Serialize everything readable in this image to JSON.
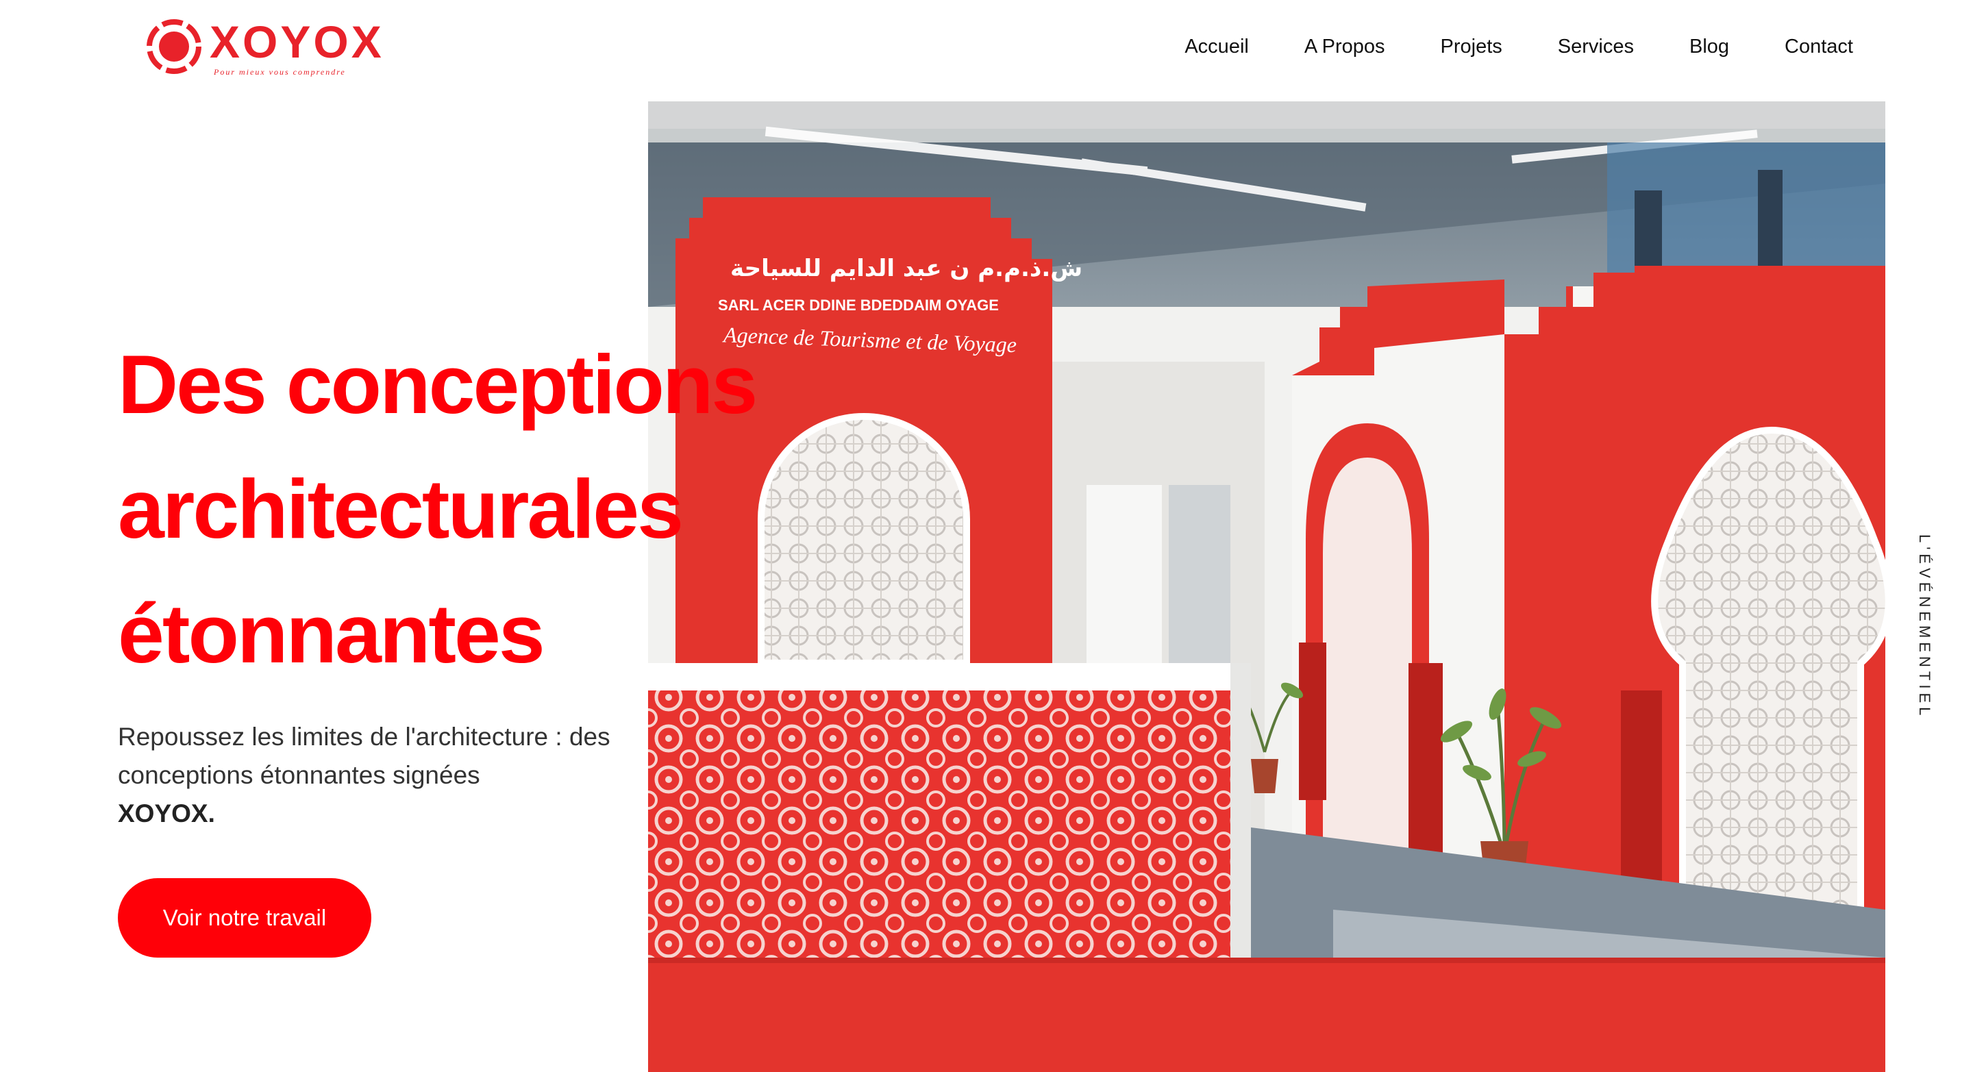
{
  "header": {
    "logo_text": "XOYOX",
    "logo_tagline": "Pour mieux vous comprendre",
    "nav": [
      {
        "label": "Accueil"
      },
      {
        "label": "A Propos"
      },
      {
        "label": "Projets"
      },
      {
        "label": "Services"
      },
      {
        "label": "Blog"
      },
      {
        "label": "Contact"
      }
    ]
  },
  "hero": {
    "title_lines": [
      "Des conceptions",
      "architecturales",
      "étonnantes"
    ],
    "subtitle": "Repoussez les limites de l'architecture : des conceptions étonnantes signées",
    "subtitle_brand": "XOYOX.",
    "cta_label": "Voir notre travail",
    "side_label": "L'ÉVÉNEMENTIEL",
    "photo": {
      "sign_arabic": "ش.ذ.م.م  ن عبد الدايم للسياحة",
      "sign_line1": "SARL  ACER  DDINE  BDEDDAIM  OYAGE",
      "sign_line2": "Agence de Tourisme et de Voyage"
    }
  },
  "colors": {
    "accent": "#ff0008",
    "brand_red": "#e8222a",
    "text_dark": "#111111",
    "text_body": "#333333"
  }
}
